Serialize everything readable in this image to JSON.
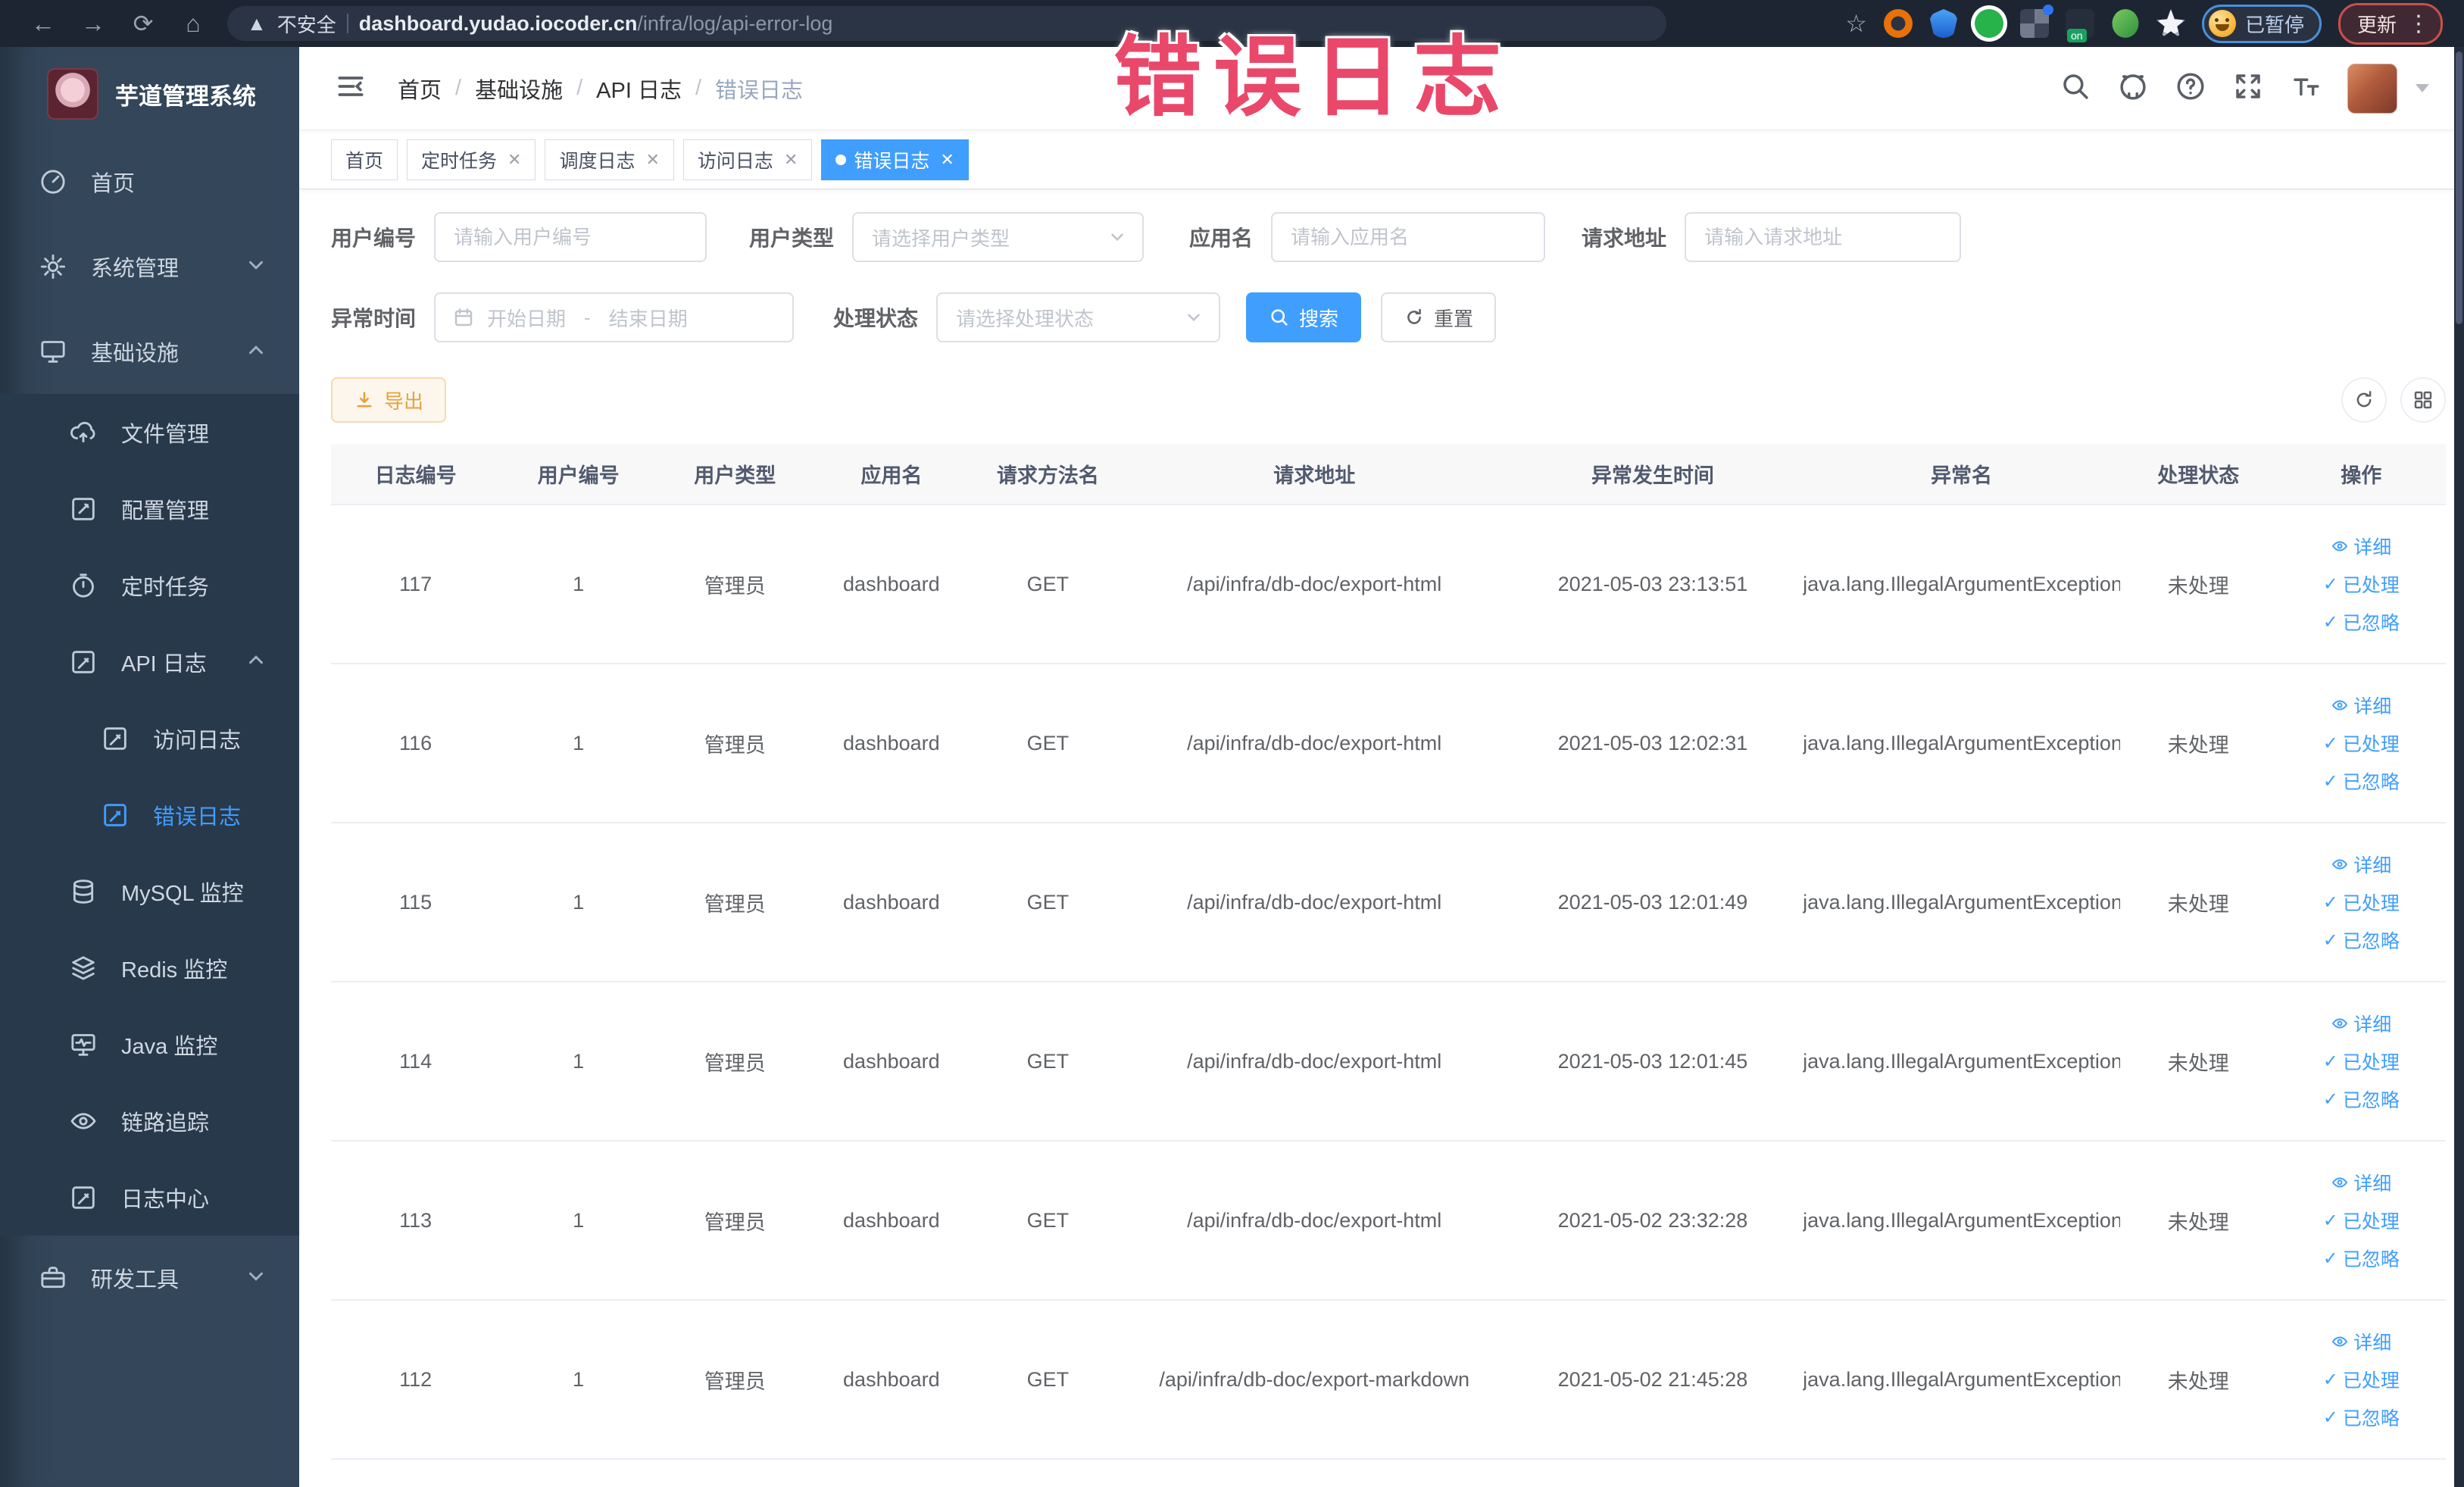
{
  "browser": {
    "secure_label": "不安全",
    "url_host": "dashboard.yudao.iocoder.cn",
    "url_path": "/infra/log/api-error-log",
    "paused_badge": "已暂停",
    "update_button": "更新"
  },
  "annotation": {
    "text": "错误日志"
  },
  "sidebar": {
    "logo_title": "芋道管理系统",
    "items": [
      {
        "label": "首页"
      },
      {
        "label": "系统管理"
      },
      {
        "label": "基础设施"
      },
      {
        "label": "文件管理"
      },
      {
        "label": "配置管理"
      },
      {
        "label": "定时任务"
      },
      {
        "label": "API 日志"
      },
      {
        "label": "访问日志"
      },
      {
        "label": "错误日志"
      },
      {
        "label": "MySQL 监控"
      },
      {
        "label": "Redis 监控"
      },
      {
        "label": "Java 监控"
      },
      {
        "label": "链路追踪"
      },
      {
        "label": "日志中心"
      },
      {
        "label": "研发工具"
      }
    ]
  },
  "breadcrumb": {
    "items": [
      "首页",
      "基础设施",
      "API 日志",
      "错误日志"
    ]
  },
  "tabs": [
    {
      "label": "首页"
    },
    {
      "label": "定时任务"
    },
    {
      "label": "调度日志"
    },
    {
      "label": "访问日志"
    },
    {
      "label": "错误日志"
    }
  ],
  "filters": {
    "user_id": {
      "label": "用户编号",
      "placeholder": "请输入用户编号"
    },
    "user_type": {
      "label": "用户类型",
      "placeholder": "请选择用户类型"
    },
    "app_name": {
      "label": "应用名",
      "placeholder": "请输入应用名"
    },
    "request_url": {
      "label": "请求地址",
      "placeholder": "请输入请求地址"
    },
    "exception_time": {
      "label": "异常时间",
      "start_placeholder": "开始日期",
      "separator": "-",
      "end_placeholder": "结束日期"
    },
    "process_status": {
      "label": "处理状态",
      "placeholder": "请选择处理状态"
    },
    "search_button": "搜索",
    "reset_button": "重置"
  },
  "toolbar": {
    "export_button": "导出"
  },
  "table": {
    "columns": [
      "日志编号",
      "用户编号",
      "用户类型",
      "应用名",
      "请求方法名",
      "请求地址",
      "异常发生时间",
      "异常名",
      "处理状态",
      "操作"
    ],
    "actions": {
      "detail": "详细",
      "processed": "已处理",
      "ignored": "已忽略"
    },
    "rows": [
      {
        "id": "117",
        "user_id": "1",
        "user_type": "管理员",
        "app": "dashboard",
        "method": "GET",
        "url": "/api/infra/db-doc/export-html",
        "time": "2021-05-03 23:13:51",
        "exception": "java.lang.IllegalArgumentException",
        "status": "未处理"
      },
      {
        "id": "116",
        "user_id": "1",
        "user_type": "管理员",
        "app": "dashboard",
        "method": "GET",
        "url": "/api/infra/db-doc/export-html",
        "time": "2021-05-03 12:02:31",
        "exception": "java.lang.IllegalArgumentException",
        "status": "未处理"
      },
      {
        "id": "115",
        "user_id": "1",
        "user_type": "管理员",
        "app": "dashboard",
        "method": "GET",
        "url": "/api/infra/db-doc/export-html",
        "time": "2021-05-03 12:01:49",
        "exception": "java.lang.IllegalArgumentException",
        "status": "未处理"
      },
      {
        "id": "114",
        "user_id": "1",
        "user_type": "管理员",
        "app": "dashboard",
        "method": "GET",
        "url": "/api/infra/db-doc/export-html",
        "time": "2021-05-03 12:01:45",
        "exception": "java.lang.IllegalArgumentException",
        "status": "未处理"
      },
      {
        "id": "113",
        "user_id": "1",
        "user_type": "管理员",
        "app": "dashboard",
        "method": "GET",
        "url": "/api/infra/db-doc/export-html",
        "time": "2021-05-02 23:32:28",
        "exception": "java.lang.IllegalArgumentException",
        "status": "未处理"
      },
      {
        "id": "112",
        "user_id": "1",
        "user_type": "管理员",
        "app": "dashboard",
        "method": "GET",
        "url": "/api/infra/db-doc/export-markdown",
        "time": "2021-05-02 21:45:28",
        "exception": "java.lang.IllegalArgumentException",
        "status": "未处理"
      }
    ]
  },
  "colors": {
    "accent": "#409eff",
    "warning": "#e6a23c",
    "annotation_pink": "#e9486b",
    "sidebar_bg": "#33465a",
    "submenu_bg": "#28394b",
    "chrome_bg": "#1d2532"
  }
}
